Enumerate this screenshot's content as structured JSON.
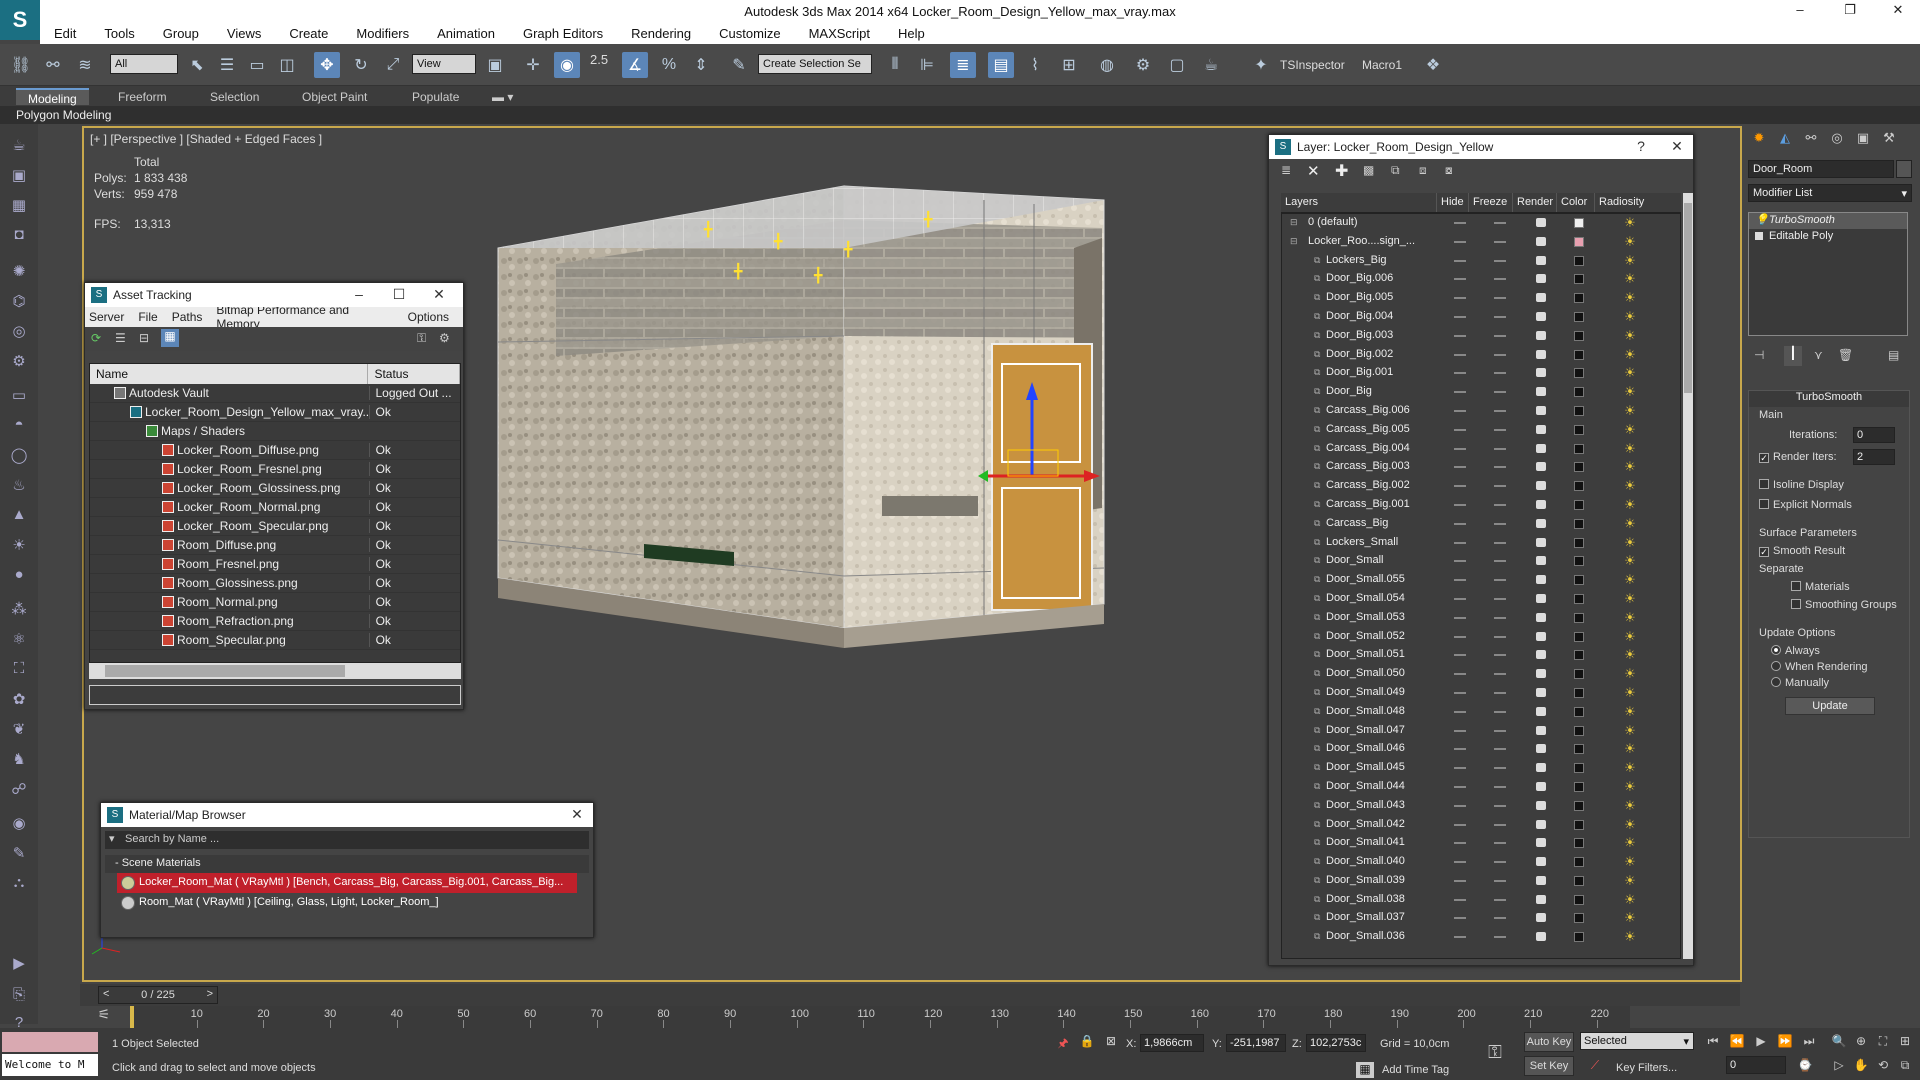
{
  "window": {
    "title": "Autodesk 3ds Max  2014 x64     Locker_Room_Design_Yellow_max_vray.max",
    "minimize": "–",
    "maximize": "❐",
    "close": "✕"
  },
  "menubar": [
    "Edit",
    "Tools",
    "Group",
    "Views",
    "Create",
    "Modifiers",
    "Animation",
    "Graph Editors",
    "Rendering",
    "Customize",
    "MAXScript",
    "Help"
  ],
  "toolbar": {
    "filter_select": "All",
    "ref_coord": "View",
    "snap_label": "2.5",
    "selection_set": "Create Selection Se",
    "ts_inspector": "TSInspector",
    "macro1": "Macro1"
  },
  "ribbon": {
    "tabs": [
      "Modeling",
      "Freeform",
      "Selection",
      "Object Paint",
      "Populate"
    ],
    "sub_label": "Polygon Modeling"
  },
  "viewport": {
    "label": "[+ ] [Perspective ] [Shaded + Edged Faces ]",
    "stats": {
      "total_label": "Total",
      "polys_label": "Polys:",
      "polys_value": "1 833 438",
      "verts_label": "Verts:",
      "verts_value": "959 478",
      "fps_label": "FPS:",
      "fps_value": "13,313"
    }
  },
  "asset_tracking": {
    "title": "Asset Tracking",
    "menus": [
      "Server",
      "File",
      "Paths",
      "Bitmap Performance and Memory",
      "Options"
    ],
    "columns": [
      "Name",
      "Status"
    ],
    "rows": [
      {
        "name": "Autodesk Vault",
        "status": "Logged Out ..."
      },
      {
        "name": "Locker_Room_Design_Yellow_max_vray....",
        "status": "Ok"
      },
      {
        "name": "Maps / Shaders",
        "status": ""
      },
      {
        "name": "Locker_Room_Diffuse.png",
        "status": "Ok"
      },
      {
        "name": "Locker_Room_Fresnel.png",
        "status": "Ok"
      },
      {
        "name": "Locker_Room_Glossiness.png",
        "status": "Ok"
      },
      {
        "name": "Locker_Room_Normal.png",
        "status": "Ok"
      },
      {
        "name": "Locker_Room_Specular.png",
        "status": "Ok"
      },
      {
        "name": "Room_Diffuse.png",
        "status": "Ok"
      },
      {
        "name": "Room_Fresnel.png",
        "status": "Ok"
      },
      {
        "name": "Room_Glossiness.png",
        "status": "Ok"
      },
      {
        "name": "Room_Normal.png",
        "status": "Ok"
      },
      {
        "name": "Room_Refraction.png",
        "status": "Ok"
      },
      {
        "name": "Room_Specular.png",
        "status": "Ok"
      }
    ]
  },
  "material_browser": {
    "title": "Material/Map Browser",
    "search_placeholder": "Search by Name ...",
    "group": "- Scene Materials",
    "materials": [
      "Locker_Room_Mat ( VRayMtl ) [Bench, Carcass_Big, Carcass_Big.001, Carcass_Big...",
      "Room_Mat ( VRayMtl ) [Ceiling, Glass, Light, Locker_Room_]"
    ]
  },
  "layer_panel": {
    "title": "Layer: Locker_Room_Design_Yellow",
    "help": "?",
    "columns": [
      "Layers",
      "Hide",
      "Freeze",
      "Render",
      "Color",
      "Radiosity"
    ],
    "layers": [
      {
        "name": "0 (default)",
        "level": 0,
        "color": "#f0f0f0"
      },
      {
        "name": "Locker_Roo....sign_...",
        "level": 0,
        "color": "#e8a0b0"
      },
      {
        "name": "Lockers_Big",
        "level": 1,
        "color": "#111111"
      },
      {
        "name": "Door_Big.006",
        "level": 1,
        "color": "#111111"
      },
      {
        "name": "Door_Big.005",
        "level": 1,
        "color": "#111111"
      },
      {
        "name": "Door_Big.004",
        "level": 1,
        "color": "#111111"
      },
      {
        "name": "Door_Big.003",
        "level": 1,
        "color": "#111111"
      },
      {
        "name": "Door_Big.002",
        "level": 1,
        "color": "#111111"
      },
      {
        "name": "Door_Big.001",
        "level": 1,
        "color": "#111111"
      },
      {
        "name": "Door_Big",
        "level": 1,
        "color": "#111111"
      },
      {
        "name": "Carcass_Big.006",
        "level": 1,
        "color": "#111111"
      },
      {
        "name": "Carcass_Big.005",
        "level": 1,
        "color": "#111111"
      },
      {
        "name": "Carcass_Big.004",
        "level": 1,
        "color": "#111111"
      },
      {
        "name": "Carcass_Big.003",
        "level": 1,
        "color": "#111111"
      },
      {
        "name": "Carcass_Big.002",
        "level": 1,
        "color": "#111111"
      },
      {
        "name": "Carcass_Big.001",
        "level": 1,
        "color": "#111111"
      },
      {
        "name": "Carcass_Big",
        "level": 1,
        "color": "#111111"
      },
      {
        "name": "Lockers_Small",
        "level": 1,
        "color": "#111111"
      },
      {
        "name": "Door_Small",
        "level": 1,
        "color": "#111111"
      },
      {
        "name": "Door_Small.055",
        "level": 1,
        "color": "#111111"
      },
      {
        "name": "Door_Small.054",
        "level": 1,
        "color": "#111111"
      },
      {
        "name": "Door_Small.053",
        "level": 1,
        "color": "#111111"
      },
      {
        "name": "Door_Small.052",
        "level": 1,
        "color": "#111111"
      },
      {
        "name": "Door_Small.051",
        "level": 1,
        "color": "#111111"
      },
      {
        "name": "Door_Small.050",
        "level": 1,
        "color": "#111111"
      },
      {
        "name": "Door_Small.049",
        "level": 1,
        "color": "#111111"
      },
      {
        "name": "Door_Small.048",
        "level": 1,
        "color": "#111111"
      },
      {
        "name": "Door_Small.047",
        "level": 1,
        "color": "#111111"
      },
      {
        "name": "Door_Small.046",
        "level": 1,
        "color": "#111111"
      },
      {
        "name": "Door_Small.045",
        "level": 1,
        "color": "#111111"
      },
      {
        "name": "Door_Small.044",
        "level": 1,
        "color": "#111111"
      },
      {
        "name": "Door_Small.043",
        "level": 1,
        "color": "#111111"
      },
      {
        "name": "Door_Small.042",
        "level": 1,
        "color": "#111111"
      },
      {
        "name": "Door_Small.041",
        "level": 1,
        "color": "#111111"
      },
      {
        "name": "Door_Small.040",
        "level": 1,
        "color": "#111111"
      },
      {
        "name": "Door_Small.039",
        "level": 1,
        "color": "#111111"
      },
      {
        "name": "Door_Small.038",
        "level": 1,
        "color": "#111111"
      },
      {
        "name": "Door_Small.037",
        "level": 1,
        "color": "#111111"
      },
      {
        "name": "Door_Small.036",
        "level": 1,
        "color": "#111111"
      }
    ]
  },
  "command_panel": {
    "object_name": "Door_Room",
    "modifier_list": "Modifier List",
    "stack": [
      "TurboSmooth",
      "Editable Poly"
    ],
    "turbosmooth": {
      "title": "TurboSmooth",
      "main": "Main",
      "iterations_label": "Iterations:",
      "iterations_value": "0",
      "render_iters_label": "Render Iters:",
      "render_iters_value": "2",
      "isoline": "Isoline Display",
      "explicit_normals": "Explicit Normals",
      "surface_params": "Surface Parameters",
      "smooth_result": "Smooth Result",
      "separate": "Separate",
      "materials": "Materials",
      "smoothing_groups": "Smoothing Groups",
      "update_options": "Update Options",
      "always": "Always",
      "when_rendering": "When Rendering",
      "manually": "Manually",
      "update_button": "Update"
    }
  },
  "timeline": {
    "frame_display": "0 / 225",
    "ticks": [
      "10",
      "20",
      "30",
      "40",
      "50",
      "60",
      "70",
      "80",
      "90",
      "100",
      "110",
      "120",
      "130",
      "140",
      "150",
      "160",
      "170",
      "180",
      "190",
      "200",
      "210",
      "220"
    ]
  },
  "statusbar": {
    "maxscript_1": "",
    "maxscript_2": "Welcome to M",
    "selection_status": "1 Object Selected",
    "prompt": "Click and drag to select and move objects",
    "x_label": "X:",
    "x_value": "1,9866cm",
    "y_label": "Y:",
    "y_value": "-251,1987",
    "z_label": "Z:",
    "z_value": "102,2753c",
    "grid": "Grid = 10,0cm",
    "add_time_tag": "Add Time Tag",
    "auto_key": "Auto Key",
    "set_key": "Set Key",
    "selected": "Selected",
    "key_filters": "Key Filters...",
    "frame": "0"
  }
}
